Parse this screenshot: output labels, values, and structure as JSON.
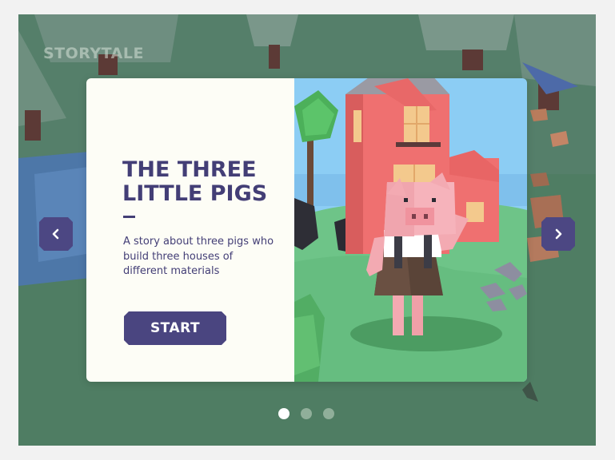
{
  "app": {
    "brand": "STORYTALE"
  },
  "story": {
    "title": "THE THREE LITTLE PIGS",
    "description": "A story about three pigs who build three houses of different materials",
    "start_label": "START"
  },
  "carousel": {
    "prev_icon": "chevron-left-icon",
    "next_icon": "chevron-right-icon",
    "total_slides": 3,
    "active_slide": 1
  },
  "colors": {
    "accent": "#4a4580",
    "card_background": "#fdfdf6",
    "scene_grass": "#6ec488",
    "scene_sky": "#8ccdf4",
    "house": "#ef7070"
  }
}
